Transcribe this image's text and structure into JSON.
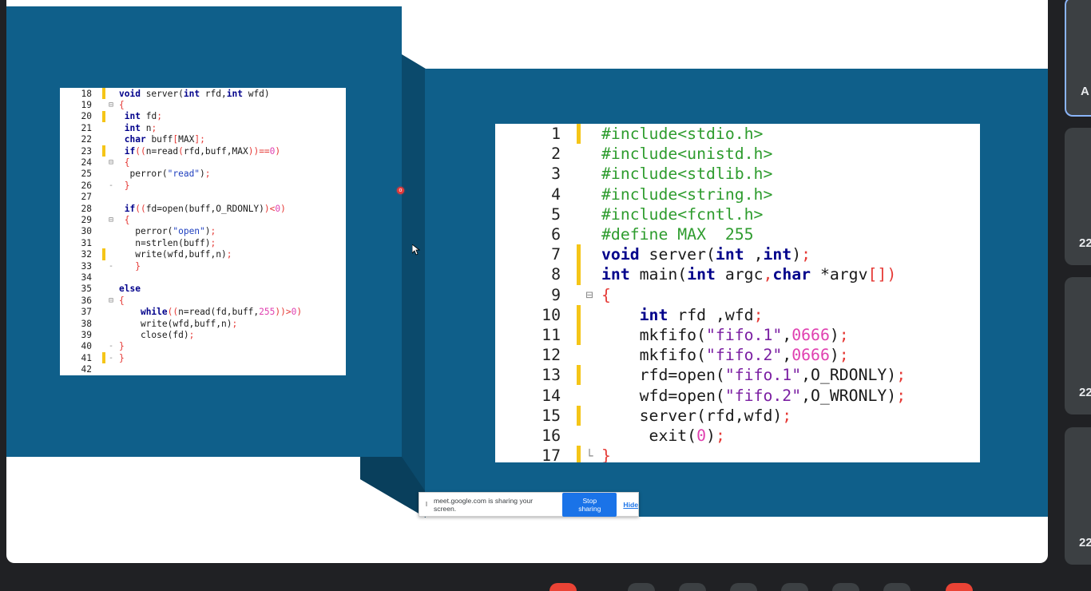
{
  "presentation": {
    "small_code": [
      {
        "n": "18",
        "mark": true,
        "fold": "",
        "tokens": [
          [
            "kw",
            "void"
          ],
          [
            "txt",
            " server("
          ],
          [
            "kw",
            "int"
          ],
          [
            "txt",
            " rfd,"
          ],
          [
            "kw",
            "int"
          ],
          [
            "txt",
            " wfd)"
          ]
        ]
      },
      {
        "n": "19",
        "mark": false,
        "fold": "⊟",
        "tokens": [
          [
            "op",
            "{"
          ]
        ]
      },
      {
        "n": "20",
        "mark": true,
        "fold": "",
        "tokens": [
          [
            "txt",
            " "
          ],
          [
            "kw",
            "int"
          ],
          [
            "txt",
            " fd"
          ],
          [
            "op",
            ";"
          ]
        ]
      },
      {
        "n": "21",
        "mark": false,
        "fold": "",
        "tokens": [
          [
            "txt",
            " "
          ],
          [
            "kw",
            "int"
          ],
          [
            "txt",
            " n"
          ],
          [
            "op",
            ";"
          ]
        ]
      },
      {
        "n": "22",
        "mark": false,
        "fold": "",
        "tokens": [
          [
            "txt",
            " "
          ],
          [
            "kw",
            "char"
          ],
          [
            "txt",
            " buff"
          ],
          [
            "op",
            "["
          ],
          [
            "txt",
            "MAX"
          ],
          [
            "op",
            "];"
          ]
        ]
      },
      {
        "n": "23",
        "mark": true,
        "fold": "",
        "tokens": [
          [
            "txt",
            " "
          ],
          [
            "kw",
            "if"
          ],
          [
            "op",
            "(("
          ],
          [
            "txt",
            "n=read"
          ],
          [
            "op",
            "("
          ],
          [
            "txt",
            "rfd,buff,MAX"
          ],
          [
            "op",
            "))=="
          ],
          [
            "num",
            "0"
          ],
          [
            "op",
            ")"
          ]
        ]
      },
      {
        "n": "24",
        "mark": false,
        "fold": "⊟",
        "tokens": [
          [
            "txt",
            " "
          ],
          [
            "op",
            "{"
          ]
        ]
      },
      {
        "n": "25",
        "mark": false,
        "fold": "",
        "tokens": [
          [
            "txt",
            "  perror("
          ],
          [
            "strblue",
            "\"read\""
          ],
          [
            "txt",
            ")"
          ],
          [
            "op",
            ";"
          ]
        ]
      },
      {
        "n": "26",
        "mark": false,
        "fold": "-",
        "tokens": [
          [
            "txt",
            " "
          ],
          [
            "op",
            "}"
          ]
        ]
      },
      {
        "n": "27",
        "mark": false,
        "fold": "",
        "tokens": []
      },
      {
        "n": "28",
        "mark": false,
        "fold": "",
        "tokens": [
          [
            "txt",
            " "
          ],
          [
            "kw",
            "if"
          ],
          [
            "op",
            "(("
          ],
          [
            "txt",
            "fd=open(buff,O_RDONLY)"
          ],
          [
            "op",
            ")<"
          ],
          [
            "num",
            "0"
          ],
          [
            "op",
            ")"
          ]
        ]
      },
      {
        "n": "29",
        "mark": false,
        "fold": "⊟",
        "tokens": [
          [
            "txt",
            " "
          ],
          [
            "op",
            "{"
          ]
        ]
      },
      {
        "n": "30",
        "mark": false,
        "fold": "",
        "tokens": [
          [
            "txt",
            "   perror("
          ],
          [
            "strblue",
            "\"open\""
          ],
          [
            "txt",
            ")"
          ],
          [
            "op",
            ";"
          ]
        ]
      },
      {
        "n": "31",
        "mark": false,
        "fold": "",
        "tokens": [
          [
            "txt",
            "   n=strlen(buff)"
          ],
          [
            "op",
            ";"
          ]
        ]
      },
      {
        "n": "32",
        "mark": true,
        "fold": "",
        "tokens": [
          [
            "txt",
            "   write(wfd,buff,n)"
          ],
          [
            "op",
            ";"
          ]
        ]
      },
      {
        "n": "33",
        "mark": false,
        "fold": "-",
        "tokens": [
          [
            "txt",
            "   "
          ],
          [
            "op",
            "}"
          ]
        ]
      },
      {
        "n": "34",
        "mark": false,
        "fold": "",
        "tokens": []
      },
      {
        "n": "35",
        "mark": false,
        "fold": "",
        "tokens": [
          [
            "kw",
            "else"
          ]
        ]
      },
      {
        "n": "36",
        "mark": false,
        "fold": "⊟",
        "tokens": [
          [
            "op",
            "{"
          ]
        ]
      },
      {
        "n": "37",
        "mark": false,
        "fold": "",
        "tokens": [
          [
            "txt",
            "    "
          ],
          [
            "kw",
            "while"
          ],
          [
            "op",
            "(("
          ],
          [
            "txt",
            "n=read(fd,buff,"
          ],
          [
            "num",
            "255"
          ],
          [
            "op",
            "))>"
          ],
          [
            "num",
            "0"
          ],
          [
            "op",
            ")"
          ]
        ]
      },
      {
        "n": "38",
        "mark": false,
        "fold": "",
        "tokens": [
          [
            "txt",
            "    write(wfd,buff,n)"
          ],
          [
            "op",
            ";"
          ]
        ]
      },
      {
        "n": "39",
        "mark": false,
        "fold": "",
        "tokens": [
          [
            "txt",
            "    close(fd)"
          ],
          [
            "op",
            ";"
          ]
        ]
      },
      {
        "n": "40",
        "mark": false,
        "fold": "-",
        "tokens": [
          [
            "op",
            "}"
          ]
        ]
      },
      {
        "n": "41",
        "mark": true,
        "fold": "-",
        "tokens": [
          [
            "op",
            "}"
          ]
        ]
      },
      {
        "n": "42",
        "mark": false,
        "fold": "",
        "tokens": []
      }
    ],
    "large_code": [
      {
        "n": "1",
        "mark": true,
        "fold": "",
        "tokens": [
          [
            "pp",
            "#include<stdio.h>"
          ]
        ]
      },
      {
        "n": "2",
        "mark": false,
        "fold": "",
        "tokens": [
          [
            "pp",
            "#include<unistd.h>"
          ]
        ]
      },
      {
        "n": "3",
        "mark": false,
        "fold": "",
        "tokens": [
          [
            "pp",
            "#include<stdlib.h>"
          ]
        ]
      },
      {
        "n": "4",
        "mark": false,
        "fold": "",
        "tokens": [
          [
            "pp",
            "#include<string.h>"
          ]
        ]
      },
      {
        "n": "5",
        "mark": false,
        "fold": "",
        "tokens": [
          [
            "pp",
            "#include<fcntl.h>"
          ]
        ]
      },
      {
        "n": "6",
        "mark": false,
        "fold": "",
        "tokens": [
          [
            "pp",
            "#define MAX  255"
          ]
        ]
      },
      {
        "n": "7",
        "mark": true,
        "fold": "",
        "tokens": [
          [
            "kw",
            "void"
          ],
          [
            "txt",
            " server("
          ],
          [
            "kw",
            "int"
          ],
          [
            "txt",
            " ,"
          ],
          [
            "kw",
            "int"
          ],
          [
            "txt",
            ")"
          ],
          [
            "op",
            ";"
          ]
        ]
      },
      {
        "n": "8",
        "mark": true,
        "fold": "",
        "tokens": [
          [
            "kw",
            "int"
          ],
          [
            "txt",
            " main("
          ],
          [
            "kw",
            "int"
          ],
          [
            "txt",
            " argc"
          ],
          [
            "op",
            ","
          ],
          [
            "kw",
            "char"
          ],
          [
            "txt",
            " *argv"
          ],
          [
            "op",
            "[])"
          ]
        ]
      },
      {
        "n": "9",
        "mark": false,
        "fold": "⊟",
        "tokens": [
          [
            "op",
            "{"
          ]
        ]
      },
      {
        "n": "10",
        "mark": true,
        "fold": "",
        "tokens": [
          [
            "txt",
            "    "
          ],
          [
            "kw",
            "int"
          ],
          [
            "txt",
            " rfd ,wfd"
          ],
          [
            "op",
            ";"
          ]
        ]
      },
      {
        "n": "11",
        "mark": true,
        "fold": "",
        "tokens": [
          [
            "txt",
            "    mkfifo("
          ],
          [
            "str",
            "\"fifo.1\""
          ],
          [
            "txt",
            ","
          ],
          [
            "num",
            "0666"
          ],
          [
            "txt",
            ")"
          ],
          [
            "op",
            ";"
          ]
        ]
      },
      {
        "n": "12",
        "mark": false,
        "fold": "",
        "tokens": [
          [
            "txt",
            "    mkfifo("
          ],
          [
            "str",
            "\"fifo.2\""
          ],
          [
            "txt",
            ","
          ],
          [
            "num",
            "0666"
          ],
          [
            "txt",
            ")"
          ],
          [
            "op",
            ";"
          ]
        ]
      },
      {
        "n": "13",
        "mark": true,
        "fold": "",
        "tokens": [
          [
            "txt",
            "    rfd=open("
          ],
          [
            "str",
            "\"fifo.1\""
          ],
          [
            "txt",
            ",O_RDONLY)"
          ],
          [
            "op",
            ";"
          ]
        ]
      },
      {
        "n": "14",
        "mark": false,
        "fold": "",
        "tokens": [
          [
            "txt",
            "    wfd=open("
          ],
          [
            "str",
            "\"fifo.2\""
          ],
          [
            "txt",
            ",O_WRONLY)"
          ],
          [
            "op",
            ";"
          ]
        ]
      },
      {
        "n": "15",
        "mark": true,
        "fold": "",
        "tokens": [
          [
            "txt",
            "    server(rfd,wfd)"
          ],
          [
            "op",
            ";"
          ]
        ]
      },
      {
        "n": "16",
        "mark": false,
        "fold": "",
        "tokens": [
          [
            "txt",
            "     exit("
          ],
          [
            "num",
            "0"
          ],
          [
            "txt",
            ")"
          ],
          [
            "op",
            ";"
          ]
        ]
      },
      {
        "n": "17",
        "mark": true,
        "fold": "└",
        "tokens": [
          [
            "op",
            "}"
          ]
        ]
      }
    ],
    "pointer_badge": "o"
  },
  "share_bar": {
    "message": "meet.google.com is sharing your screen.",
    "stop_label": "Stop sharing",
    "hide_label": "Hide"
  },
  "participants": [
    {
      "label": "A"
    },
    {
      "label": "22"
    },
    {
      "label": "22"
    },
    {
      "label": "22"
    }
  ],
  "colors": {
    "slide_bg": "#0f5f8a",
    "change_marker": "#f5c518",
    "keyword": "#00008b",
    "preprocessor": "#2e9c2e",
    "accent": "#1a73e8"
  }
}
